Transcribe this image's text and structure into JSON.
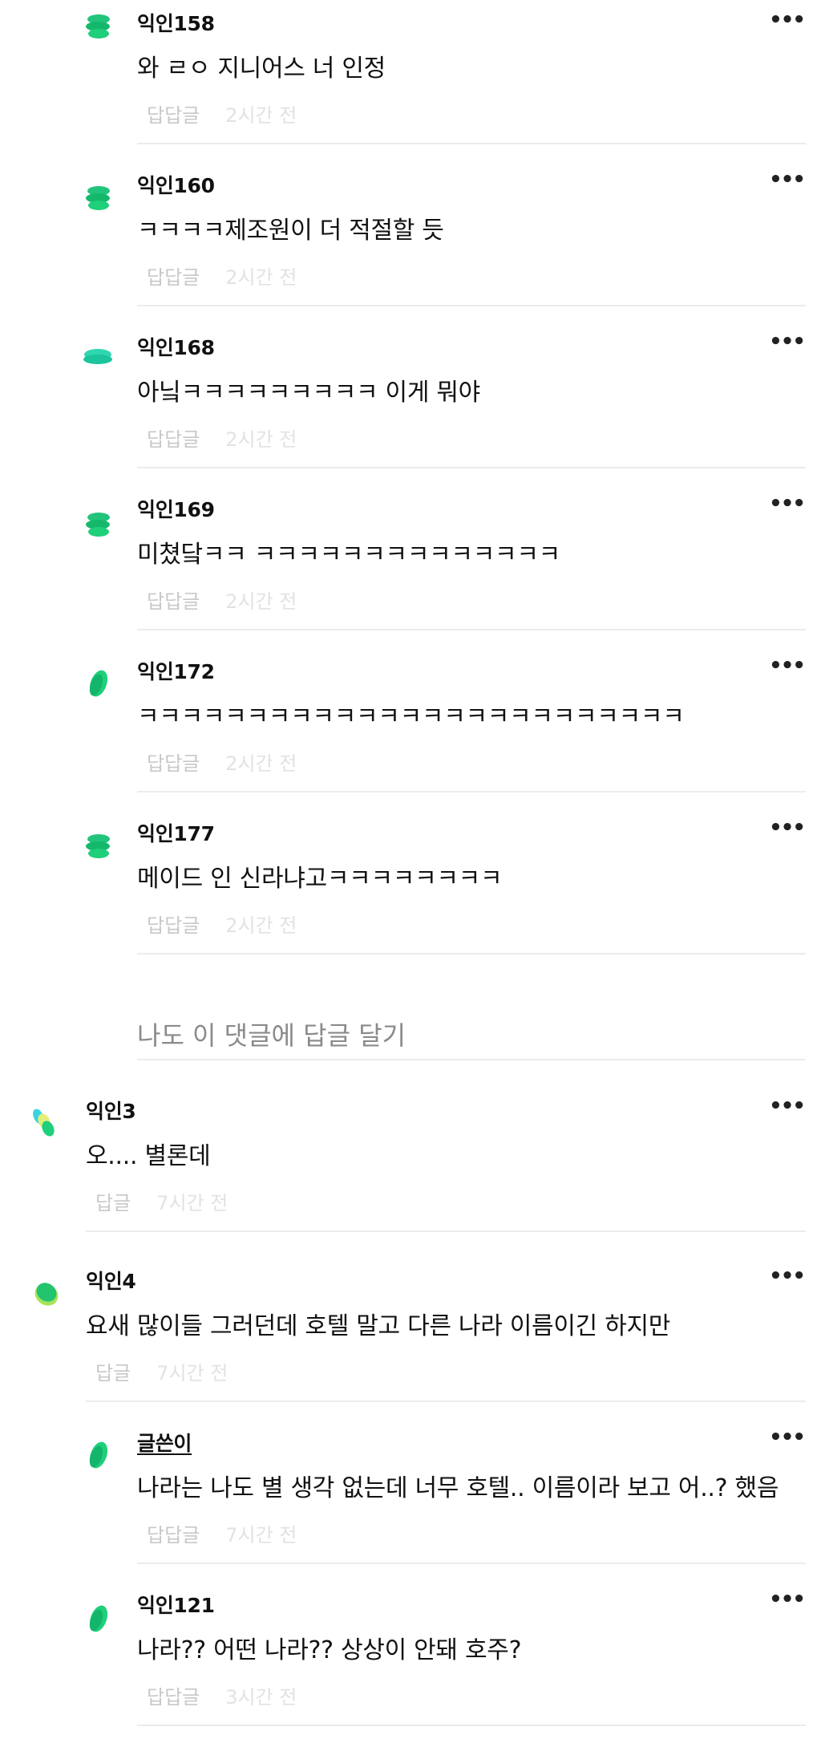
{
  "reply_label": "답답글",
  "top_reply_label": "답글",
  "more_label": "•••",
  "replies": [
    {
      "nick": "익인158",
      "text": "와 ㄹㅇ 지니어스 너 인정",
      "time": "2시간 전"
    },
    {
      "nick": "익인160",
      "text": "ㅋㅋㅋㅋ제조원이 더 적절할 듯",
      "time": "2시간 전"
    },
    {
      "nick": "익인168",
      "text": "아닠ㅋㅋㅋㅋㅋㅋㅋㅋㅋ 이게 뭐야",
      "time": "2시간 전"
    },
    {
      "nick": "익인169",
      "text": "미쳤닼ㅋㅋ ㅋㅋㅋㅋㅋㅋㅋㅋㅋㅋㅋㅋㅋㅋ",
      "time": "2시간 전"
    },
    {
      "nick": "익인172",
      "text": "ㅋㅋㅋㅋㅋㅋㅋㅋㅋㅋㅋㅋㅋㅋㅋㅋㅋㅋㅋㅋㅋㅋㅋㅋㅋ",
      "time": "2시간 전"
    },
    {
      "nick": "익인177",
      "text": "메이드 인 신라냐고ㅋㅋㅋㅋㅋㅋㅋㅋ",
      "time": "2시간 전"
    }
  ],
  "reply_prompt": "나도 이 댓글에 답글 달기",
  "comments": [
    {
      "nick": "익인3",
      "text": "오.... 별론데",
      "time": "7시간 전"
    },
    {
      "nick": "익인4",
      "text": "요새 많이들 그러던데 호텔 말고 다른 나라 이름이긴 하지만",
      "time": "7시간 전"
    }
  ],
  "sub_replies": [
    {
      "nick": "글쓴이",
      "text": "나라는 나도 별 생각 없는데 너무 호텔.. 이름이라 보고 어..? 했음",
      "time": "7시간 전"
    },
    {
      "nick": "익인121",
      "text": "나라?? 어떤 나라?? 상상이 안돼 호주?",
      "time": "3시간 전"
    }
  ],
  "colors": {
    "avatar_green": "#1fcf7a",
    "avatar_teal": "#2fd6b0",
    "avatar_lime": "#a7e35a",
    "avatar_cyan": "#3ad3e0"
  }
}
